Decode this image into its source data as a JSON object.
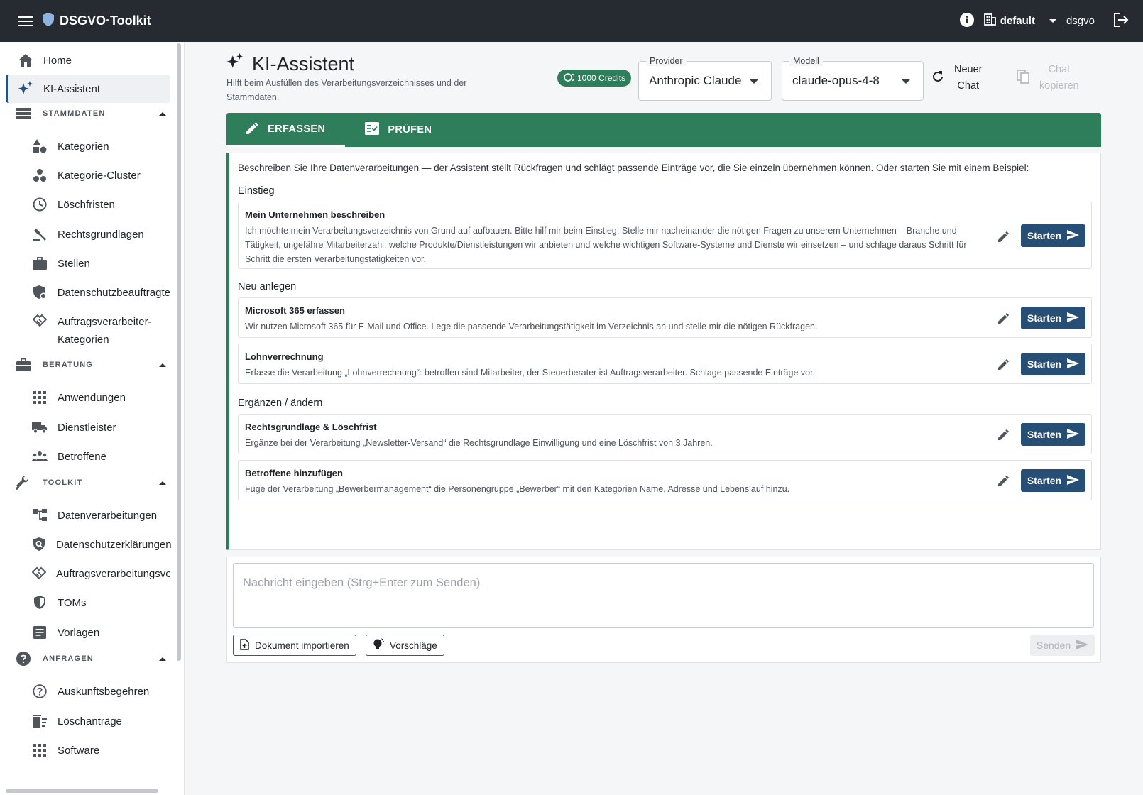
{
  "topbar": {
    "brand": "DSGVO·Toolkit",
    "tenant": "default",
    "user": "dsgvo"
  },
  "sidebar": {
    "home": "Home",
    "assistant": "KI-Assistent",
    "sections": {
      "stammdaten": "STAMMDATEN",
      "beratung": "BERATUNG",
      "toolkit": "TOOLKIT",
      "anfragen": "ANFRAGEN"
    },
    "stammdaten_items": [
      "Kategorien",
      "Kategorie-Cluster",
      "Löschfristen",
      "Rechtsgrundlagen",
      "Stellen",
      "Datenschutzbeauftragte",
      "Auftragsverarbeiter-",
      "Kategorien"
    ],
    "beratung_items": [
      "Anwendungen",
      "Dienstleister",
      "Betroffene"
    ],
    "toolkit_items": [
      "Datenverarbeitungen",
      "Datenschutzerklärungen",
      "Auftragsverarbeitungsve",
      "TOMs",
      "Vorlagen"
    ],
    "anfragen_items": [
      "Auskunftsbegehren",
      "Löschanträge",
      "Software"
    ]
  },
  "header": {
    "title": "KI-Assistent",
    "subtitle": "Hilft beim Ausfüllen des Verarbeitungsverzeichnisses und der Stammdaten.",
    "credits": "1000 Credits",
    "provider_label": "Provider",
    "provider_value": "Anthropic Claude",
    "model_label": "Modell",
    "model_value": "claude-opus-4-8",
    "new_chat_line1": "Neuer",
    "new_chat_line2": "Chat",
    "copy_chat_line1": "Chat",
    "copy_chat_line2": "kopieren"
  },
  "tabs": {
    "capture": "ERFASSEN",
    "check": "PRÜFEN"
  },
  "panel": {
    "intro": "Beschreiben Sie Ihre Datenverarbeitungen — der Assistent stellt Rückfragen und schlägt passende Einträge vor, die Sie einzeln übernehmen können. Oder starten Sie mit einem Beispiel:",
    "groups": {
      "einstieg": "Einstieg",
      "neu": "Neu anlegen",
      "aendern": "Ergänzen / ändern"
    },
    "start_label": "Starten",
    "cards": [
      {
        "title": "Mein Unternehmen beschreiben",
        "desc": "Ich möchte mein Verarbeitungsverzeichnis von Grund auf aufbauen. Bitte hilf mir beim Einstieg: Stelle mir nacheinander die nötigen Fragen zu unserem Unternehmen – Branche und Tätigkeit, ungefähre Mitarbeiterzahl, welche Produkte/Dienstleistungen wir anbieten und welche wichtigen Software-Systeme und Dienste wir einsetzen – und schlage daraus Schritt für Schritt die ersten Verarbeitungstätigkeiten vor."
      },
      {
        "title": "Microsoft 365 erfassen",
        "desc": "Wir nutzen Microsoft 365 für E-Mail und Office. Lege die passende Verarbeitungstätigkeit im Verzeichnis an und stelle mir die nötigen Rückfragen."
      },
      {
        "title": "Lohnverrechnung",
        "desc": "Erfasse die Verarbeitung „Lohnverrechnung“: betroffen sind Mitarbeiter, der Steuerberater ist Auftragsverarbeiter. Schlage passende Einträge vor."
      },
      {
        "title": "Rechtsgrundlage & Löschfrist",
        "desc": "Ergänze bei der Verarbeitung „Newsletter-Versand“ die Rechtsgrundlage Einwilligung und eine Löschfrist von 3 Jahren."
      },
      {
        "title": "Betroffene hinzufügen",
        "desc": "Füge der Verarbeitung „Bewerbermanagement“ die Personengruppe „Bewerber“ mit den Kategorien Name, Adresse und Lebenslauf hinzu."
      }
    ]
  },
  "composer": {
    "placeholder": "Nachricht eingeben (Strg+Enter zum Senden)",
    "import_label": "Dokument importieren",
    "suggestions_label": "Vorschläge",
    "send_label": "Senden"
  },
  "colors": {
    "topbar": "#262b31",
    "accent_green": "#2e7d5b",
    "button_blue": "#274e75"
  }
}
